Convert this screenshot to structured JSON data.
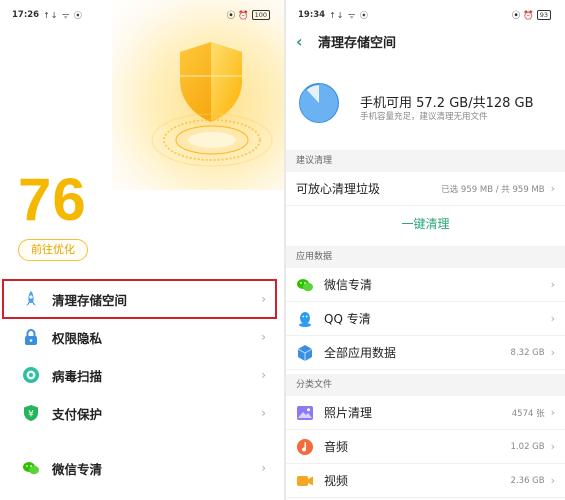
{
  "left": {
    "status": {
      "time": "17:26",
      "sym": "↑↓ ᯤ ⦿",
      "icons": "⦿ ⏰",
      "battery": "100"
    },
    "score": "76",
    "optimize_label": "前往优化",
    "items": [
      {
        "label": "清理存储空间",
        "icon": "rocket-icon"
      },
      {
        "label": "权限隐私",
        "icon": "lock-icon"
      },
      {
        "label": "病毒扫描",
        "icon": "scan-icon"
      },
      {
        "label": "支付保护",
        "icon": "payment-shield-icon"
      },
      {
        "label": "微信专清",
        "icon": "wechat-icon"
      }
    ],
    "chevron": "›",
    "colors": {
      "accent": "#f5b800",
      "highlight": "#d0202a"
    }
  },
  "right": {
    "status": {
      "time": "19:34",
      "sym": "↑↓ ᯤ ⦿",
      "icons": "⦿ ⏰",
      "battery": "93"
    },
    "back": "‹",
    "title": "清理存储空间",
    "storage": {
      "main": "手机可用 57.2 GB/共128 GB",
      "sub": "手机容量充足，建议清理无用文件"
    },
    "sections": {
      "suggest": "建议清理",
      "apps": "应用数据",
      "category": "分类文件"
    },
    "junk": {
      "label": "可放心清理垃圾",
      "value": "已选 959 MB / 共 959 MB"
    },
    "one_click": "一键清理",
    "app_items": [
      {
        "label": "微信专清",
        "value": "",
        "icon": "wechat-icon"
      },
      {
        "label": "QQ 专清",
        "value": "",
        "icon": "qq-icon"
      },
      {
        "label": "全部应用数据",
        "value": "8.32 GB",
        "icon": "cube-icon"
      }
    ],
    "file_items": [
      {
        "label": "照片清理",
        "value": "4574 张",
        "icon": "photo-icon"
      },
      {
        "label": "音频",
        "value": "1.02 GB",
        "icon": "music-icon"
      },
      {
        "label": "视频",
        "value": "2.36 GB",
        "icon": "video-icon"
      }
    ],
    "chevron": "›",
    "colors": {
      "accent": "#2aa575",
      "blue": "#3a8fe0"
    }
  }
}
